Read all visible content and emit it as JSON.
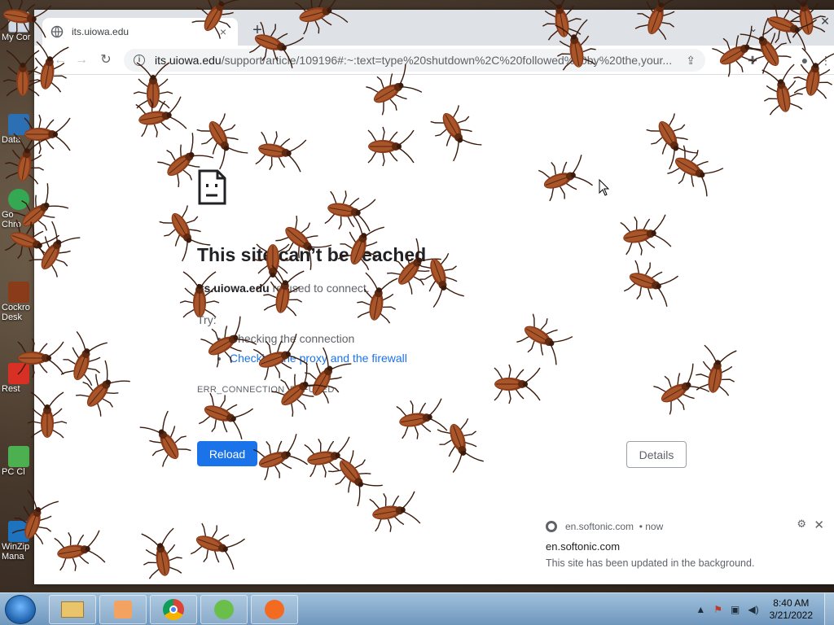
{
  "desktop": {
    "icons": [
      {
        "label": "My Cor"
      },
      {
        "label": "Data"
      },
      {
        "label": "Go\nChro"
      },
      {
        "label": "Cockro\nDesk"
      },
      {
        "label": "Rest"
      },
      {
        "label": "PC Cl"
      },
      {
        "label": "WinZip\nMana"
      }
    ]
  },
  "browser": {
    "tab": {
      "title": "its.uiowa.edu",
      "close": "×"
    },
    "new_tab": "+",
    "tab_dropdown": "⌄",
    "window_controls": {
      "close": "✕"
    },
    "nav": {
      "back": "←",
      "forward": "→",
      "reload": "↻"
    },
    "address": {
      "host": "its.uiowa.edu",
      "path": "/support/article/109196#:~:text=type%20shutdown%2C%20followed%20by%20the,your..."
    }
  },
  "error_page": {
    "title": "This site can’t be reached",
    "host": "its.uiowa.edu",
    "desc_rest": " refused to connect.",
    "try_label": "Try:",
    "suggestions": [
      {
        "text": "Checking the connection",
        "link": false
      },
      {
        "text": "Checking the proxy and the firewall",
        "link": true
      }
    ],
    "error_code": "ERR_CONNECTION_REFUSED",
    "reload_label": "Reload",
    "details_label": "Details"
  },
  "notification": {
    "source": "en.softonic.com",
    "time": "• now",
    "title": "en.softonic.com",
    "body": "This site has been updated in the background."
  },
  "taskbar": {
    "clock_time": "8:40 AM",
    "clock_date": "3/21/2022",
    "tray_arrow": "▲"
  },
  "colors": {
    "accent": "#1a73e8",
    "roach_body": "#8a3b1a",
    "taskbar": "#8fb2d3"
  }
}
